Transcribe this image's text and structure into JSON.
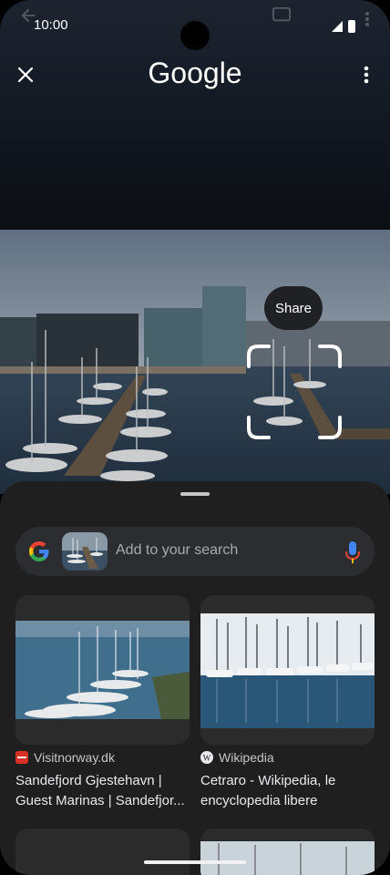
{
  "status": {
    "time": "10:00"
  },
  "appbar": {
    "brand": "Google",
    "close_icon": "close-icon",
    "more_icon": "more-vert-icon"
  },
  "photo": {
    "share_label": "Share"
  },
  "search": {
    "placeholder": "Add to your search",
    "mic_icon": "mic-icon",
    "logo_icon": "google-g-icon"
  },
  "results": [
    {
      "source": "Visitnorway.dk",
      "title_line1": "Sandefjord Gjestehavn |",
      "title_line2": "Guest Marinas | Sandefjor..."
    },
    {
      "source": "Wikipedia",
      "title_line1": "Cetraro - Wikipedia, le",
      "title_line2": "encyclopedia libere"
    }
  ],
  "colors": {
    "sheet": "#1f1f1f",
    "searchbox": "#2c2d30",
    "accent_blue": "#4285F4",
    "accent_red": "#EA4335",
    "accent_yellow": "#FBBC05",
    "accent_green": "#34A853"
  }
}
